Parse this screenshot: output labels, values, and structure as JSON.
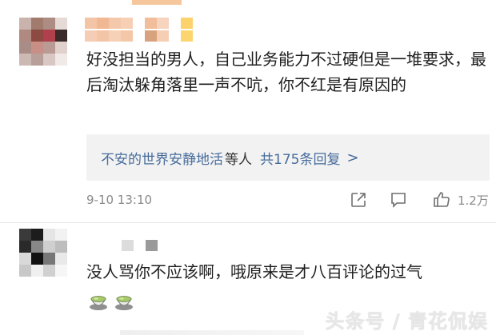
{
  "comments": [
    {
      "text": "好没担当的男人，自己业务能力不过硬但是一堆要求，最后淘汰躲角落里一声不吭，你不红是有原因的",
      "reply_summary": {
        "users": "不安的世界安静地活",
        "suffix": "等人",
        "count_text": "共175条回复",
        "chevron": ">"
      },
      "timestamp": "9-10 13:10",
      "like_count": "1.2万",
      "icons": [
        "share-icon",
        "comment-icon",
        "like-icon"
      ]
    },
    {
      "text": "没人骂你不应该啊，哦原来是才八百评论的过气",
      "emoji": [
        "tea-emoji",
        "tea-emoji"
      ]
    }
  ],
  "watermark": "头条号 / 青花侃娱",
  "colors": {
    "link": "#476c9c",
    "meta": "#8a8a8a",
    "reply_bg": "#f2f2f2"
  }
}
